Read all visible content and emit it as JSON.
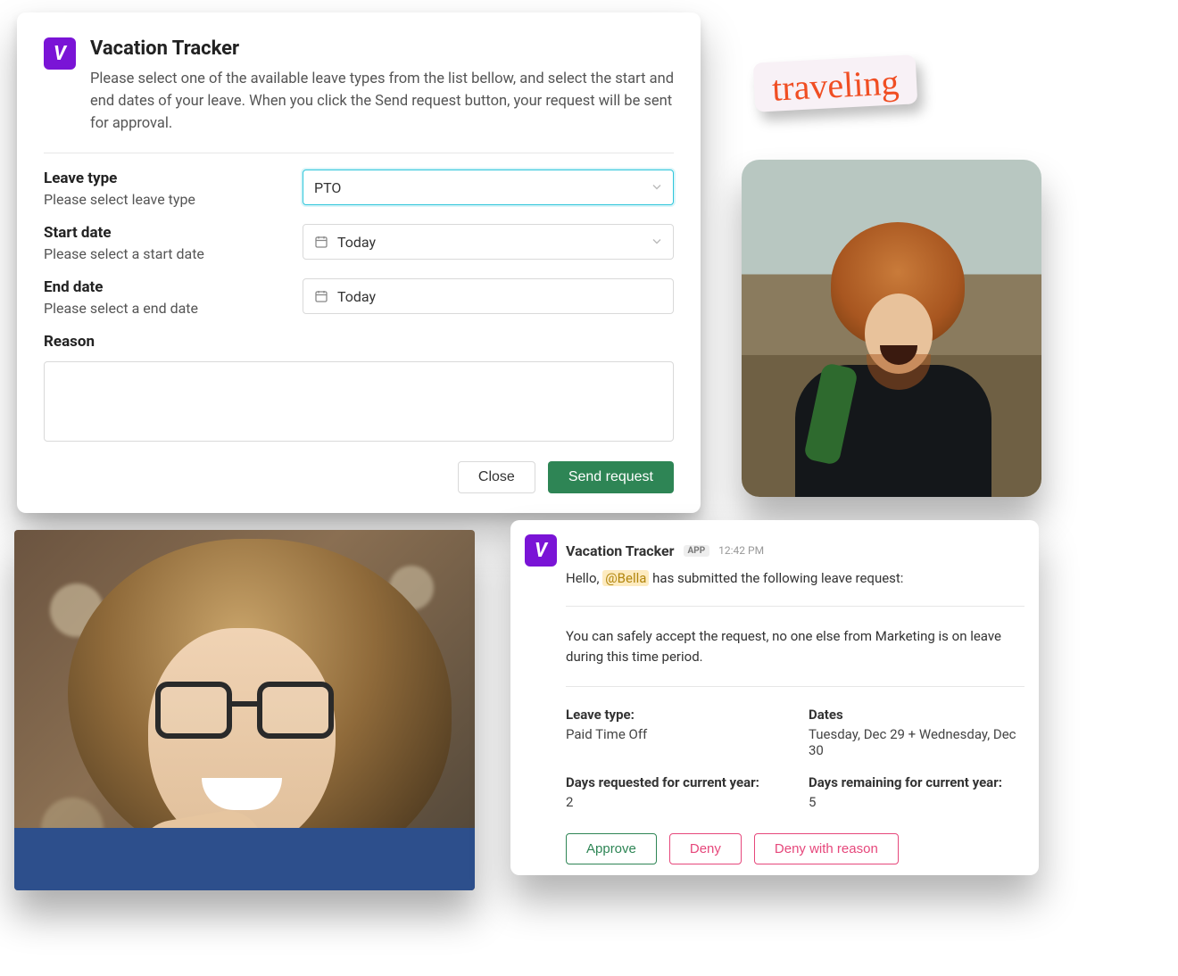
{
  "app_icon_glyph": "V",
  "request_modal": {
    "title": "Vacation Tracker",
    "description": "Please select one of the available leave types from the list bellow, and select the start and end dates of your leave. When you click the Send request button, your request will be sent for approval.",
    "leave_type": {
      "label": "Leave type",
      "sub": "Please select leave type",
      "value": "PTO"
    },
    "start_date": {
      "label": "Start date",
      "sub": "Please select a start date",
      "value": "Today"
    },
    "end_date": {
      "label": "End date",
      "sub": "Please select a end date",
      "value": "Today"
    },
    "reason": {
      "label": "Reason",
      "value": ""
    },
    "actions": {
      "close": "Close",
      "send": "Send request"
    }
  },
  "sticker_text": "traveling",
  "message": {
    "app_name": "Vacation Tracker",
    "badge": "APP",
    "time": "12:42 PM",
    "intro_prefix": "Hello, ",
    "mention": "@Bella",
    "intro_suffix": " has submitted the following leave request:",
    "safety_text": "You can safely accept the request, no one else from Marketing is on leave during this time period.",
    "leave_type_label": "Leave type:",
    "leave_type_value": "Paid Time Off",
    "dates_label": "Dates",
    "dates_value": "Tuesday, Dec 29 + Wednesday, Dec 30",
    "days_req_label": "Days requested for current year:",
    "days_req_value": "2",
    "days_rem_label": "Days remaining for current year:",
    "days_rem_value": "5",
    "actions": {
      "approve": "Approve",
      "deny": "Deny",
      "deny_reason": "Deny with reason"
    }
  }
}
